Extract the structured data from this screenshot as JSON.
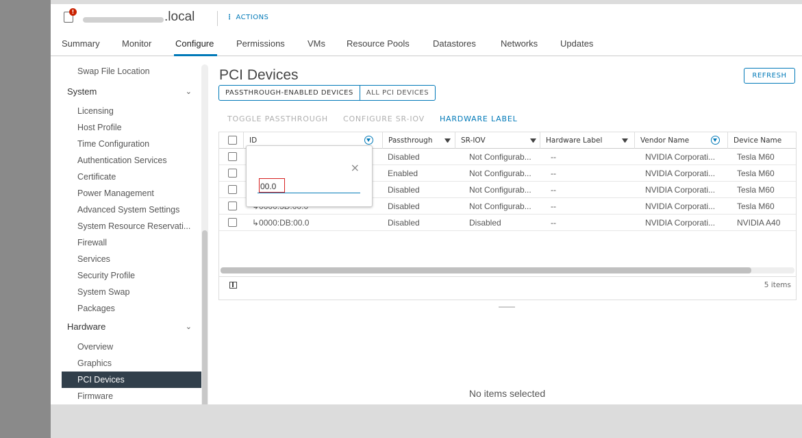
{
  "header": {
    "host_suffix": ".local",
    "actions_label": "ACTIONS"
  },
  "tabs": [
    {
      "label": "Summary"
    },
    {
      "label": "Monitor"
    },
    {
      "label": "Configure"
    },
    {
      "label": "Permissions"
    },
    {
      "label": "VMs"
    },
    {
      "label": "Resource Pools"
    },
    {
      "label": "Datastores"
    },
    {
      "label": "Networks"
    },
    {
      "label": "Updates"
    }
  ],
  "sidebar": {
    "items": [
      {
        "label": "Swap File Location"
      },
      {
        "label": "System"
      },
      {
        "label": "Licensing"
      },
      {
        "label": "Host Profile"
      },
      {
        "label": "Time Configuration"
      },
      {
        "label": "Authentication Services"
      },
      {
        "label": "Certificate"
      },
      {
        "label": "Power Management"
      },
      {
        "label": "Advanced System Settings"
      },
      {
        "label": "System Resource Reservati..."
      },
      {
        "label": "Firewall"
      },
      {
        "label": "Services"
      },
      {
        "label": "Security Profile"
      },
      {
        "label": "System Swap"
      },
      {
        "label": "Packages"
      },
      {
        "label": "Hardware"
      },
      {
        "label": "Overview"
      },
      {
        "label": "Graphics"
      },
      {
        "label": "PCI Devices"
      },
      {
        "label": "Firmware"
      }
    ]
  },
  "main": {
    "title": "PCI Devices",
    "refresh_label": "REFRESH",
    "segments": [
      "PASSTHROUGH-ENABLED DEVICES",
      "ALL PCI DEVICES"
    ],
    "actions": {
      "toggle": "TOGGLE PASSTHROUGH",
      "sriov": "CONFIGURE SR-IOV",
      "hwlabel": "HARDWARE LABEL"
    },
    "columns": [
      "ID",
      "Passthrough",
      "SR-IOV",
      "Hardware Label",
      "Vendor Name",
      "Device Name"
    ],
    "rows": [
      {
        "id": "",
        "passthrough": "Disabled",
        "sriov": "Not Configurab...",
        "hwlabel": "--",
        "vendor": "NVIDIA Corporati...",
        "device": "Tesla M60"
      },
      {
        "id": "",
        "passthrough": "Enabled",
        "sriov": "Not Configurab...",
        "hwlabel": "--",
        "vendor": "NVIDIA Corporati...",
        "device": "Tesla M60"
      },
      {
        "id": "",
        "passthrough": "Disabled",
        "sriov": "Not Configurab...",
        "hwlabel": "--",
        "vendor": "NVIDIA Corporati...",
        "device": "Tesla M60"
      },
      {
        "id": "↳0000:3D:00.0",
        "passthrough": "Disabled",
        "sriov": "Not Configurab...",
        "hwlabel": "--",
        "vendor": "NVIDIA Corporati...",
        "device": "Tesla M60"
      },
      {
        "id": "↳0000:DB:00.0",
        "passthrough": "Disabled",
        "sriov": "Disabled",
        "hwlabel": "--",
        "vendor": "NVIDIA Corporati...",
        "device": "NVIDIA A40"
      }
    ],
    "items_count": "5 items",
    "no_items": "No items selected",
    "filter_popup": {
      "value": "00.0",
      "close_glyph": "×"
    }
  },
  "colors": {
    "accent": "#0079b8",
    "sidebar_active_bg": "#313f4b",
    "alert": "#c92100",
    "highlight_box": "#d62020"
  }
}
